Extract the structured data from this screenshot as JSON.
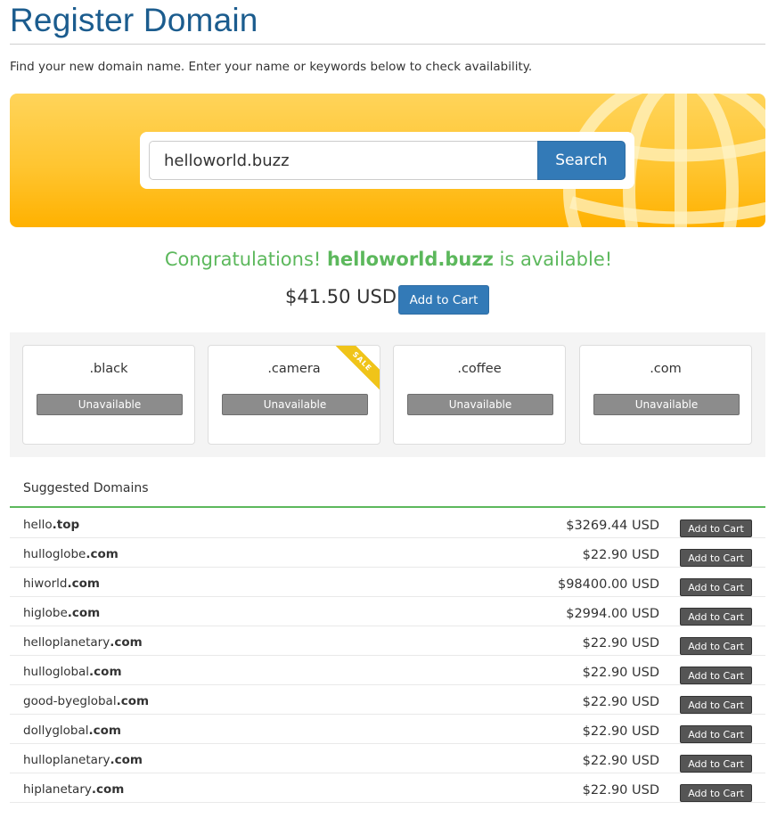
{
  "page": {
    "title": "Register Domain",
    "intro": "Find your new domain name. Enter your name or keywords below to check availability."
  },
  "search": {
    "value": "helloworld.buzz",
    "button_label": "Search"
  },
  "result": {
    "prefix": "Congratulations! ",
    "domain": "helloworld.buzz",
    "suffix": " is available!",
    "price": "$41.50 USD",
    "add_label": "Add to Cart",
    "status_color": "#5cb85c"
  },
  "tlds": [
    {
      "name": ".black",
      "status": "Unavailable"
    },
    {
      "name": ".camera",
      "status": "Unavailable",
      "ribbon": "SALE"
    },
    {
      "name": ".coffee",
      "status": "Unavailable"
    },
    {
      "name": ".com",
      "status": "Unavailable"
    }
  ],
  "suggested": {
    "heading": "Suggested Domains",
    "add_label": "Add to Cart",
    "rows": [
      {
        "sld": "hello",
        "tld": ".top",
        "price": "$3269.44 USD"
      },
      {
        "sld": "hulloglobe",
        "tld": ".com",
        "price": "$22.90 USD"
      },
      {
        "sld": "hiworld",
        "tld": ".com",
        "price": "$98400.00 USD"
      },
      {
        "sld": "higlobe",
        "tld": ".com",
        "price": "$2994.00 USD"
      },
      {
        "sld": "helloplanetary",
        "tld": ".com",
        "price": "$22.90 USD"
      },
      {
        "sld": "hulloglobal",
        "tld": ".com",
        "price": "$22.90 USD"
      },
      {
        "sld": "good-byeglobal",
        "tld": ".com",
        "price": "$22.90 USD"
      },
      {
        "sld": "dollyglobal",
        "tld": ".com",
        "price": "$22.90 USD"
      },
      {
        "sld": "hulloplanetary",
        "tld": ".com",
        "price": "$22.90 USD"
      },
      {
        "sld": "hiplanetary",
        "tld": ".com",
        "price": "$22.90 USD"
      }
    ]
  },
  "colors": {
    "brand": "#1b5c8e",
    "primary_button": "#337ab7",
    "hero_yellow": "#ffc530",
    "success": "#5cb85c"
  }
}
